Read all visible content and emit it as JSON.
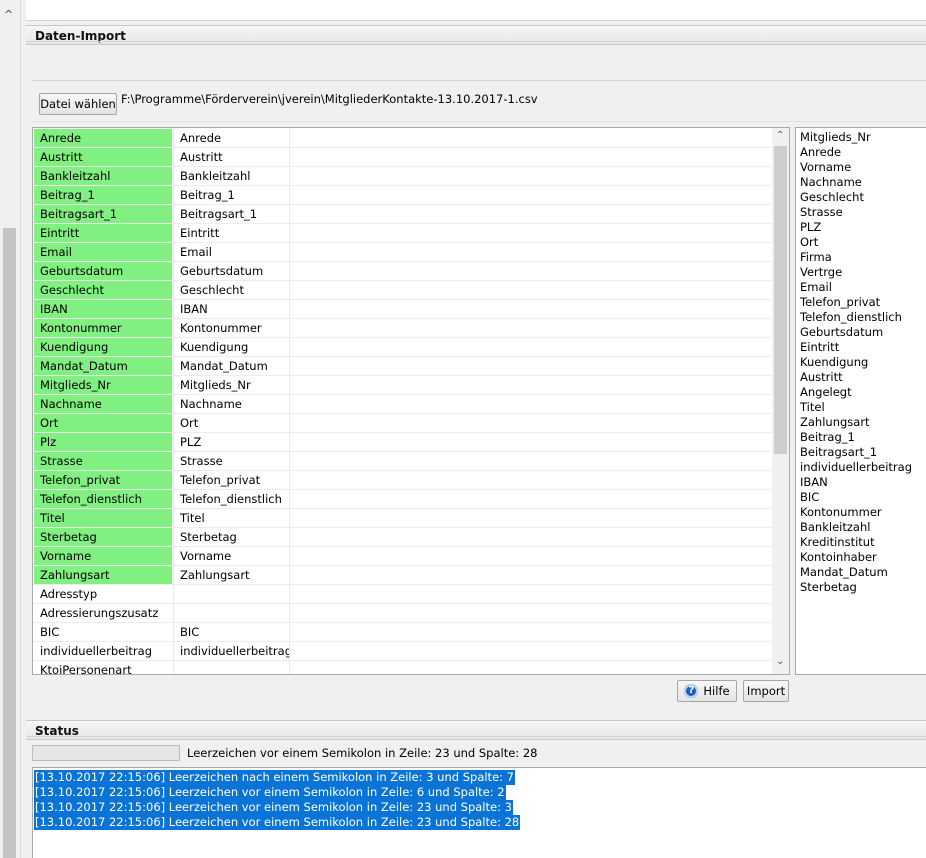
{
  "left_strip": {
    "chevron": "^"
  },
  "import_section": {
    "title": "Daten-Import"
  },
  "file": {
    "button_label": "Datei wählen",
    "path": "F:\\Programme\\Förderverein\\jverein\\MitgliederKontakte-13.10.2017-1.csv"
  },
  "mapping_rows": [
    {
      "source": "Anrede",
      "target": "Anrede",
      "mapped": true
    },
    {
      "source": "Austritt",
      "target": "Austritt",
      "mapped": true
    },
    {
      "source": "Bankleitzahl",
      "target": "Bankleitzahl",
      "mapped": true
    },
    {
      "source": "Beitrag_1",
      "target": "Beitrag_1",
      "mapped": true
    },
    {
      "source": "Beitragsart_1",
      "target": "Beitragsart_1",
      "mapped": true
    },
    {
      "source": "Eintritt",
      "target": "Eintritt",
      "mapped": true
    },
    {
      "source": "Email",
      "target": "Email",
      "mapped": true
    },
    {
      "source": "Geburtsdatum",
      "target": "Geburtsdatum",
      "mapped": true
    },
    {
      "source": "Geschlecht",
      "target": "Geschlecht",
      "mapped": true
    },
    {
      "source": "IBAN",
      "target": "IBAN",
      "mapped": true
    },
    {
      "source": "Kontonummer",
      "target": "Kontonummer",
      "mapped": true
    },
    {
      "source": "Kuendigung",
      "target": "Kuendigung",
      "mapped": true
    },
    {
      "source": "Mandat_Datum",
      "target": "Mandat_Datum",
      "mapped": true
    },
    {
      "source": "Mitglieds_Nr",
      "target": "Mitglieds_Nr",
      "mapped": true
    },
    {
      "source": "Nachname",
      "target": "Nachname",
      "mapped": true
    },
    {
      "source": "Ort",
      "target": "Ort",
      "mapped": true
    },
    {
      "source": "Plz",
      "target": "PLZ",
      "mapped": true
    },
    {
      "source": "Strasse",
      "target": "Strasse",
      "mapped": true
    },
    {
      "source": "Telefon_privat",
      "target": "Telefon_privat",
      "mapped": true
    },
    {
      "source": "Telefon_dienstlich",
      "target": "Telefon_dienstlich",
      "mapped": true
    },
    {
      "source": "Titel",
      "target": "Titel",
      "mapped": true
    },
    {
      "source": "Sterbetag",
      "target": "Sterbetag",
      "mapped": true
    },
    {
      "source": "Vorname",
      "target": "Vorname",
      "mapped": true
    },
    {
      "source": "Zahlungsart",
      "target": "Zahlungsart",
      "mapped": true
    },
    {
      "source": "Adresstyp",
      "target": "",
      "mapped": false
    },
    {
      "source": "Adressierungszusatz",
      "target": "",
      "mapped": false
    },
    {
      "source": "BIC",
      "target": "BIC",
      "mapped": false
    },
    {
      "source": "individuellerbeitrag",
      "target": "individuellerbeitrag",
      "mapped": false
    },
    {
      "source": "KtoiPersonenart",
      "target": "",
      "mapped": false
    }
  ],
  "scrollbar": {
    "up": "⌃",
    "down": "⌄"
  },
  "csv_fields": [
    "Mitglieds_Nr",
    "Anrede",
    "Vorname",
    "Nachname",
    "Geschlecht",
    "Strasse",
    "PLZ",
    "Ort",
    "Firma",
    "Vertrge",
    "Email",
    "Telefon_privat",
    "Telefon_dienstlich",
    "Geburtsdatum",
    "Eintritt",
    "Kuendigung",
    "Austritt",
    "Angelegt",
    "Titel",
    "Zahlungsart",
    "Beitrag_1",
    "Beitragsart_1",
    "individuellerbeitrag",
    "IBAN",
    "BIC",
    "Kontonummer",
    "Bankleitzahl",
    "Kreditinstitut",
    "Kontoinhaber",
    "Mandat_Datum",
    "Sterbetag"
  ],
  "buttons": {
    "help_label": "Hilfe",
    "help_icon": "?",
    "import_label": "Import"
  },
  "status_section": {
    "title": "Status",
    "current_message": "Leerzeichen vor einem Semikolon in Zeile: 23 und Spalte: 28",
    "log": [
      "[13.10.2017 22:15:06] Leerzeichen nach einem Semikolon in Zeile: 3 und Spalte: 7",
      "[13.10.2017 22:15:06] Leerzeichen vor einem Semikolon in Zeile: 6 und Spalte: 2",
      "[13.10.2017 22:15:06] Leerzeichen vor einem Semikolon in Zeile: 23 und Spalte: 3",
      "[13.10.2017 22:15:06] Leerzeichen vor einem Semikolon in Zeile: 23 und Spalte: 28"
    ]
  },
  "colors": {
    "mapped_green": "#80f080",
    "selection_blue": "#0a74d6"
  }
}
